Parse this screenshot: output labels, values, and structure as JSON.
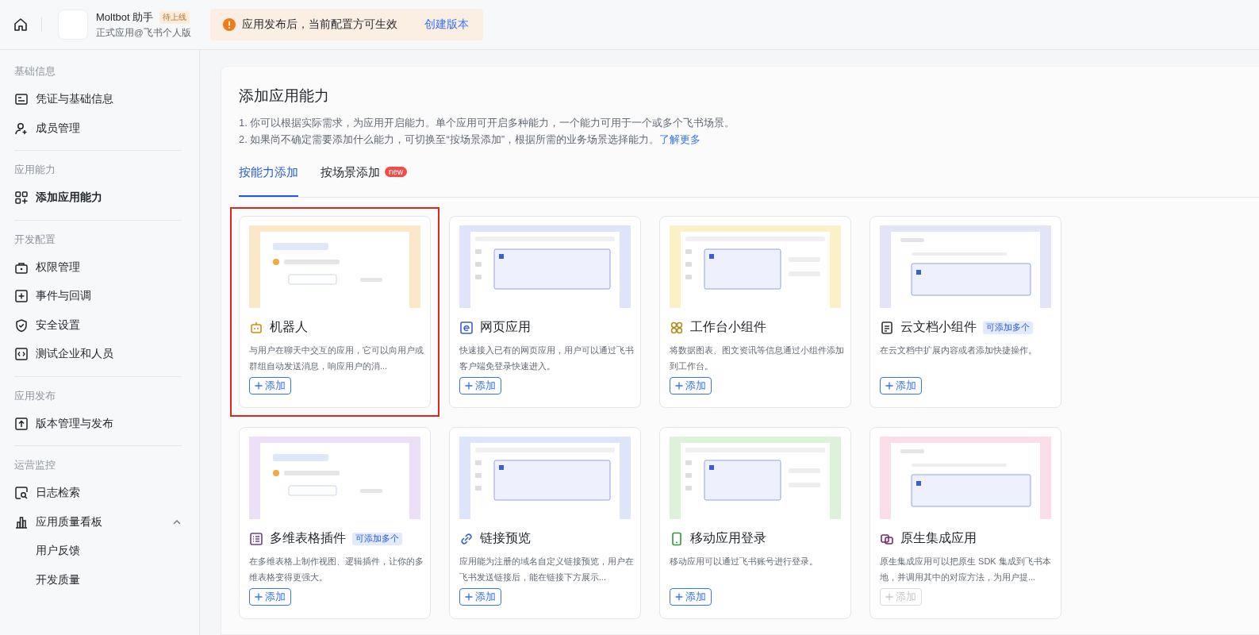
{
  "topbar": {
    "app_name": "Moltbot 助手",
    "status_badge": "待上线",
    "app_subtitle": "正式应用@飞书个人版",
    "notice": {
      "text": "应用发布后，当前配置方可生效",
      "link": "创建版本"
    }
  },
  "sidebar": {
    "sections": [
      {
        "title": "基础信息",
        "items": [
          {
            "label": "凭证与基础信息",
            "selected": false
          },
          {
            "label": "成员管理",
            "selected": false
          }
        ]
      },
      {
        "title": "应用能力",
        "items": [
          {
            "label": "添加应用能力",
            "selected": true
          }
        ]
      },
      {
        "title": "开发配置",
        "items": [
          {
            "label": "权限管理",
            "selected": false
          },
          {
            "label": "事件与回调",
            "selected": false
          },
          {
            "label": "安全设置",
            "selected": false
          },
          {
            "label": "测试企业和人员",
            "selected": false
          }
        ]
      },
      {
        "title": "应用发布",
        "items": [
          {
            "label": "版本管理与发布",
            "selected": false
          }
        ]
      },
      {
        "title": "运营监控",
        "items": [
          {
            "label": "日志检索",
            "selected": false
          },
          {
            "label": "应用质量看板",
            "selected": false,
            "expanded": true,
            "children": [
              {
                "label": "用户反馈",
                "selected": false
              },
              {
                "label": "开发质量",
                "selected": false
              }
            ]
          }
        ]
      }
    ]
  },
  "main": {
    "title": "添加应用能力",
    "notes": [
      "1. 你可以根据实际需求，为应用开启能力。单个应用可开启多种能力，一个能力可用于一个或多个飞书场景。",
      "2. 如果尚不确定需要添加什么能力，可切换至“按场景添加”，根据所需的业务场景选择能力。"
    ],
    "learn_more": "了解更多",
    "tabs": [
      {
        "label": "按能力添加",
        "selected": true
      },
      {
        "label": "按场景添加",
        "selected": false,
        "badge": "new"
      }
    ],
    "cards": [
      {
        "title": "机器人",
        "description": "与用户在聊天中交互的应用，它可以向用户或群组自动发送消息，响应用户的消...",
        "button": "添加",
        "disabled": false,
        "highlighted": true
      },
      {
        "title": "网页应用",
        "description": "快速接入已有的网页应用，用户可以通过飞书客户端免登录快速进入。",
        "button": "添加",
        "disabled": false,
        "highlighted": false
      },
      {
        "title": "工作台小组件",
        "description": "将数据图表、图文资讯等信息通过小组件添加到工作台。",
        "button": "添加",
        "disabled": false,
        "highlighted": false
      },
      {
        "title": "云文档小组件",
        "tag": "可添加多个",
        "description": "在云文档中扩展内容或者添加快捷操作。",
        "button": "添加",
        "disabled": false,
        "highlighted": false
      },
      {
        "title": "多维表格插件",
        "tag": "可添加多个",
        "description": "在多维表格上制作视图、逻辑插件，让你的多维表格变得更强大。",
        "button": "添加",
        "disabled": false,
        "highlighted": false
      },
      {
        "title": "链接预览",
        "description": "应用能为注册的域名自定义链接预览，用户在飞书发送链接后，能在链接下方展示...",
        "button": "添加",
        "disabled": false,
        "highlighted": false
      },
      {
        "title": "移动应用登录",
        "description": "移动应用可以通过飞书账号进行登录。",
        "button": "添加",
        "disabled": false,
        "highlighted": false
      },
      {
        "title": "原生集成应用",
        "description": "原生集成应用可以把原生 SDK 集成到飞书本地，并调用其中的对应方法，为用户提...",
        "button": "添加",
        "disabled": true,
        "highlighted": false
      }
    ]
  }
}
